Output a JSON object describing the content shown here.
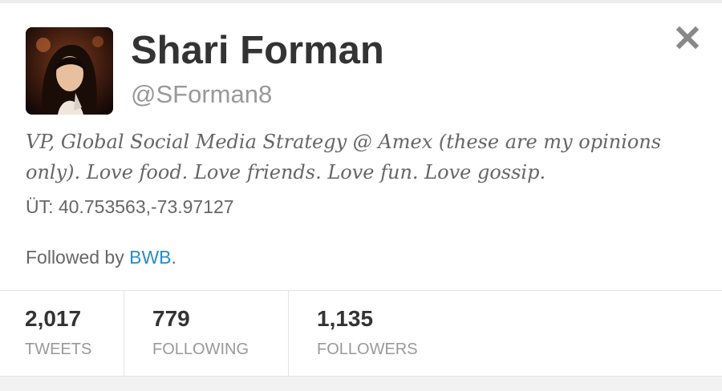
{
  "profile": {
    "name": "Shari Forman",
    "handle": "@SForman8",
    "bio": "VP, Global Social Media Strategy @ Amex (these are my opinions only). Love food. Love friends. Love fun. Love gossip.",
    "location": "ÜT: 40.753563,-73.97127",
    "followed_by_prefix": "Followed by ",
    "followed_by_user": "BWB",
    "followed_by_suffix": "."
  },
  "stats": [
    {
      "value": "2,017",
      "label": "TWEETS"
    },
    {
      "value": "779",
      "label": "FOLLOWING"
    },
    {
      "value": "1,135",
      "label": "FOLLOWERS"
    }
  ],
  "icons": {
    "close": "close-icon",
    "avatar": "profile-photo"
  },
  "colors": {
    "link": "#2a8cc8",
    "name": "#333333",
    "muted": "#999999",
    "body": "#666666"
  }
}
